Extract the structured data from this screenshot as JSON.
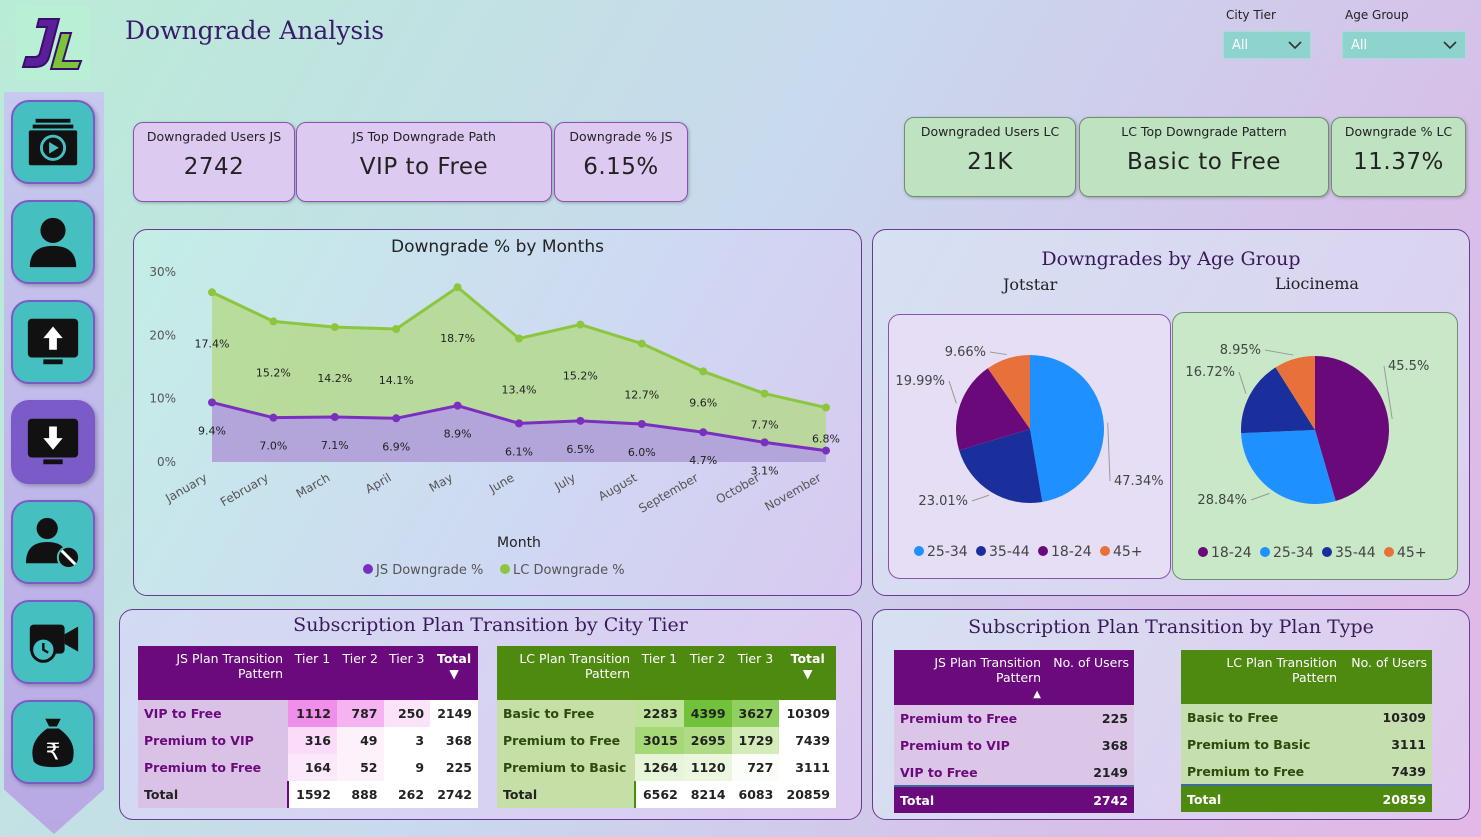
{
  "header": {
    "title": "Downgrade Analysis"
  },
  "slicers": [
    {
      "label": "City Tier",
      "value": "All"
    },
    {
      "label": "Age Group",
      "value": "All"
    }
  ],
  "nav": [
    {
      "icon": "video-library-icon"
    },
    {
      "icon": "user-icon"
    },
    {
      "icon": "upgrade-monitor-icon"
    },
    {
      "icon": "downgrade-monitor-icon"
    },
    {
      "icon": "user-blocked-icon"
    },
    {
      "icon": "video-time-icon"
    },
    {
      "icon": "rupee-bag-icon"
    }
  ],
  "kpis": {
    "js": [
      {
        "label": "Downgraded Users JS",
        "value": "2742"
      },
      {
        "label": "JS Top Downgrade Path",
        "value": "VIP to Free"
      },
      {
        "label": "Downgrade % JS",
        "value": "6.15%"
      }
    ],
    "lc": [
      {
        "label": "Downgraded Users LC",
        "value": "21K"
      },
      {
        "label": "LC Top Downgrade Pattern",
        "value": "Basic to Free"
      },
      {
        "label": "Downgrade % LC",
        "value": "11.37%"
      }
    ]
  },
  "line_panel": {
    "title": "Downgrade % by Months",
    "xlabel": "Month"
  },
  "pie_panel": {
    "title": "Downgrades by Age Group",
    "js_subtitle": "Jotstar",
    "lc_subtitle": "Liocinema"
  },
  "city_panel": {
    "title": "Subscription Plan Transition by City Tier"
  },
  "plan_panel": {
    "title": "Subscription Plan Transition by Plan Type"
  },
  "colors": {
    "js": "#7b2fbe",
    "lc": "#8cc63f",
    "age_25_34": "#1e90ff",
    "age_35_44": "#1a2f9c",
    "age_18_24": "#6a0a7a",
    "age_45_plus": "#e8703a"
  },
  "chart_data": [
    {
      "type": "area",
      "title": "Downgrade % by Months",
      "xlabel": "Month",
      "ylabel": "",
      "categories": [
        "January",
        "February",
        "March",
        "April",
        "May",
        "June",
        "July",
        "August",
        "September",
        "October",
        "November"
      ],
      "yticks": [
        "0%",
        "10%",
        "20%",
        "30%"
      ],
      "ylim": [
        0,
        30
      ],
      "legend": "bottom",
      "series": [
        {
          "name": "JS Downgrade %",
          "values": [
            9.4,
            7.0,
            7.1,
            6.9,
            8.9,
            6.1,
            6.5,
            6.0,
            4.7,
            3.1,
            1.8
          ],
          "labels": [
            "9.4%",
            "7.0%",
            "7.1%",
            "6.9%",
            "8.9%",
            "6.1%",
            "6.5%",
            "6.0%",
            "4.7%",
            "3.1%",
            ""
          ]
        },
        {
          "name": "LC Downgrade %",
          "values": [
            26.8,
            22.2,
            21.3,
            21.0,
            27.6,
            19.5,
            21.7,
            18.7,
            14.3,
            10.8,
            8.6
          ],
          "labels": [
            "17.4%",
            "15.2%",
            "14.2%",
            "14.1%",
            "18.7%",
            "13.4%",
            "15.2%",
            "12.7%",
            "9.6%",
            "7.7%",
            "6.8%"
          ]
        }
      ]
    },
    {
      "type": "pie",
      "subtitle": "Jotstar",
      "slices": [
        {
          "name": "25-34",
          "value": 47.34,
          "label": "47.34%"
        },
        {
          "name": "35-44",
          "value": 23.01,
          "label": "23.01%"
        },
        {
          "name": "18-24",
          "value": 19.99,
          "label": "19.99%"
        },
        {
          "name": "45+",
          "value": 9.66,
          "label": "9.66%"
        }
      ],
      "legend": [
        "25-34",
        "35-44",
        "18-24",
        "45+"
      ]
    },
    {
      "type": "pie",
      "subtitle": "Liocinema",
      "slices": [
        {
          "name": "18-24",
          "value": 45.5,
          "label": "45.5%"
        },
        {
          "name": "25-34",
          "value": 28.84,
          "label": "28.84%"
        },
        {
          "name": "35-44",
          "value": 16.72,
          "label": "16.72%"
        },
        {
          "name": "45+",
          "value": 8.95,
          "label": "8.95%"
        }
      ],
      "legend": [
        "18-24",
        "25-34",
        "35-44",
        "45+"
      ]
    }
  ],
  "js_city_table": {
    "headers": [
      "JS Plan Transition Pattern",
      "Tier 1",
      "Tier 2",
      "Tier 3",
      "Total"
    ],
    "rows": [
      [
        "VIP to Free",
        "1112",
        "787",
        "250",
        "2149"
      ],
      [
        "Premium to VIP",
        "316",
        "49",
        "3",
        "368"
      ],
      [
        "Premium to Free",
        "164",
        "52",
        "9",
        "225"
      ]
    ],
    "total": [
      "Total",
      "1592",
      "888",
      "262",
      "2742"
    ]
  },
  "lc_city_table": {
    "headers": [
      "LC Plan Transition Pattern",
      "Tier 1",
      "Tier 2",
      "Tier 3",
      "Total"
    ],
    "rows": [
      [
        "Basic to Free",
        "2283",
        "4399",
        "3627",
        "10309"
      ],
      [
        "Premium to Free",
        "3015",
        "2695",
        "1729",
        "7439"
      ],
      [
        "Premium to Basic",
        "1264",
        "1120",
        "727",
        "3111"
      ]
    ],
    "total": [
      "Total",
      "6562",
      "8214",
      "6083",
      "20859"
    ]
  },
  "js_plan_table": {
    "headers": [
      "JS Plan Transition Pattern",
      "No. of Users"
    ],
    "rows": [
      [
        "Premium to Free",
        "225"
      ],
      [
        "Premium to VIP",
        "368"
      ],
      [
        "VIP to Free",
        "2149"
      ]
    ],
    "total": [
      "Total",
      "2742"
    ]
  },
  "lc_plan_table": {
    "headers": [
      "LC Plan Transition Pattern",
      "No. of Users"
    ],
    "rows": [
      [
        "Basic to Free",
        "10309"
      ],
      [
        "Premium to Basic",
        "3111"
      ],
      [
        "Premium to Free",
        "7439"
      ]
    ],
    "total": [
      "Total",
      "20859"
    ]
  }
}
